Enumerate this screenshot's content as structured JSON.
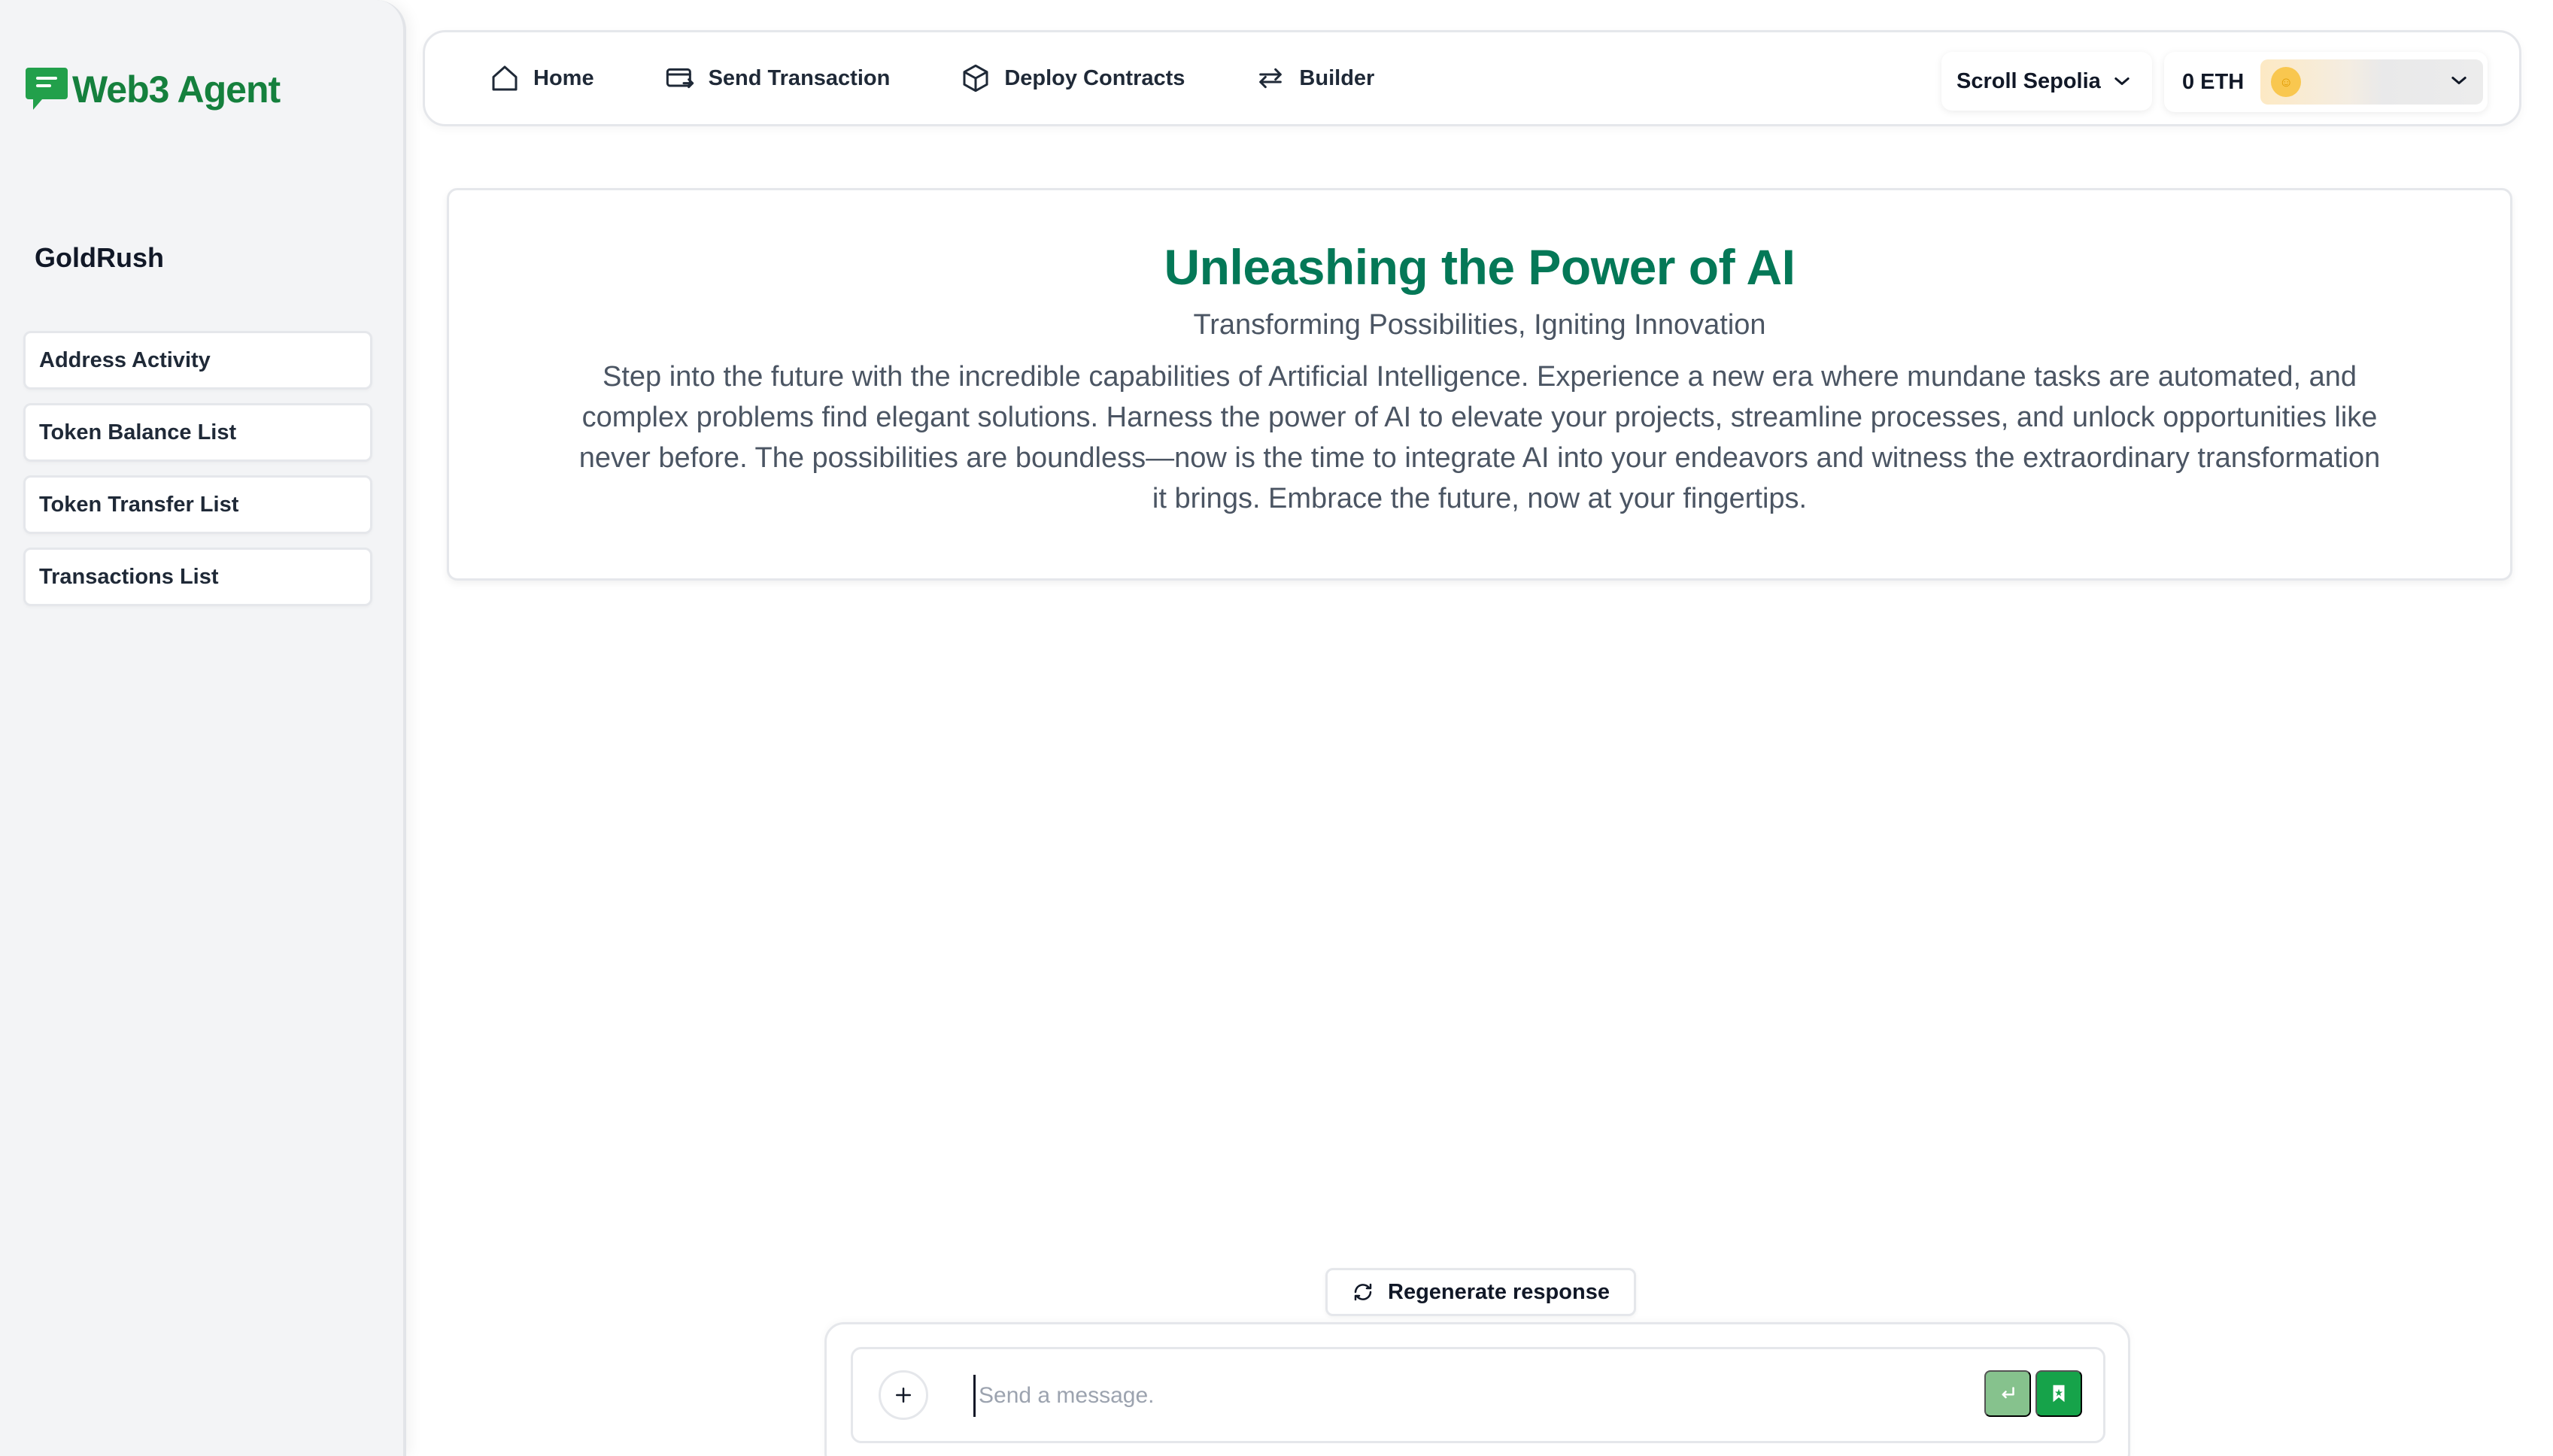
{
  "brand": {
    "name": "Web3 Agent",
    "icon": "chat-bubble-icon",
    "color": "#15803d"
  },
  "sidebar": {
    "section_title": "GoldRush",
    "items": [
      {
        "label": "Address Activity"
      },
      {
        "label": "Token Balance List"
      },
      {
        "label": "Token Transfer List"
      },
      {
        "label": "Transactions List"
      }
    ]
  },
  "nav": {
    "links": [
      {
        "label": "Home",
        "icon": "home-icon"
      },
      {
        "label": "Send Transaction",
        "icon": "credit-card-send-icon"
      },
      {
        "label": "Deploy Contracts",
        "icon": "cube-icon"
      },
      {
        "label": "Builder",
        "icon": "arrows-exchange-icon"
      }
    ],
    "network": "Scroll Sepolia",
    "balance": "0 ETH"
  },
  "hero": {
    "title": "Unleashing the Power of AI",
    "subtitle": "Transforming Possibilities, Igniting Innovation",
    "body": "Step into the future with the incredible capabilities of Artificial Intelligence. Experience a new era where mundane tasks are automated, and complex problems find elegant solutions. Harness the power of AI to elevate your projects, streamline processes, and unlock opportunities like never before. The possibilities are boundless—now is the time to integrate AI into your endeavors and witness the extraordinary transformation it brings. Embrace the future, now at your fingertips.",
    "title_color": "#047857"
  },
  "chat": {
    "regenerate_label": "Regenerate response",
    "input_placeholder": "Send a message.",
    "input_value": ""
  },
  "colors": {
    "accent": "#16a34a",
    "accent_light": "#86c28d",
    "sidebar_bg": "#f3f4f6"
  }
}
